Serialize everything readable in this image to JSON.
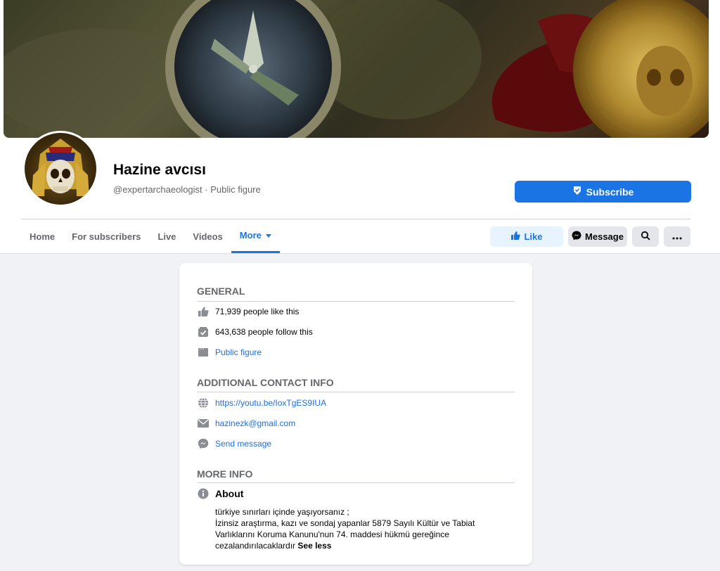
{
  "page": {
    "name": "Hazine avcısı",
    "handle": "@expertarchaeologist · Public figure"
  },
  "header": {
    "subscribe_label": "Subscribe"
  },
  "nav": {
    "tabs": [
      {
        "label": "Home"
      },
      {
        "label": "For subscribers"
      },
      {
        "label": "Live"
      },
      {
        "label": "Videos"
      },
      {
        "label": "More"
      }
    ],
    "like_label": "Like",
    "message_label": "Message"
  },
  "about": {
    "general_title": "GENERAL",
    "likes_text": "71,939 people like this",
    "follows_text": "643,638 people follow this",
    "category_text": "Public figure",
    "contact_title": "ADDITIONAL CONTACT INFO",
    "website": "https://youtu.be/IoxTgES9IUA",
    "email": "hazinezk@gmail.com",
    "send_message": "Send message",
    "more_info_title": "MORE INFO",
    "about_label": "About",
    "about_line1": "türkiye sınırları içinde yaşıyorsanız ;",
    "about_line2": "İzinsiz araştırma, kazı ve sondaj yapanlar 5879 Sayılı Kültür ve Tabiat",
    "about_line3": "Varlıklarını Koruma Kanunu'nun 74. maddesi hükmü gereğince",
    "about_line4": "cezalandırılacaklardır",
    "see_less": "See less"
  },
  "colors": {
    "accent": "#1b74e4",
    "link": "#216fdb",
    "muted": "#65676b",
    "background": "#f0f2f5"
  }
}
